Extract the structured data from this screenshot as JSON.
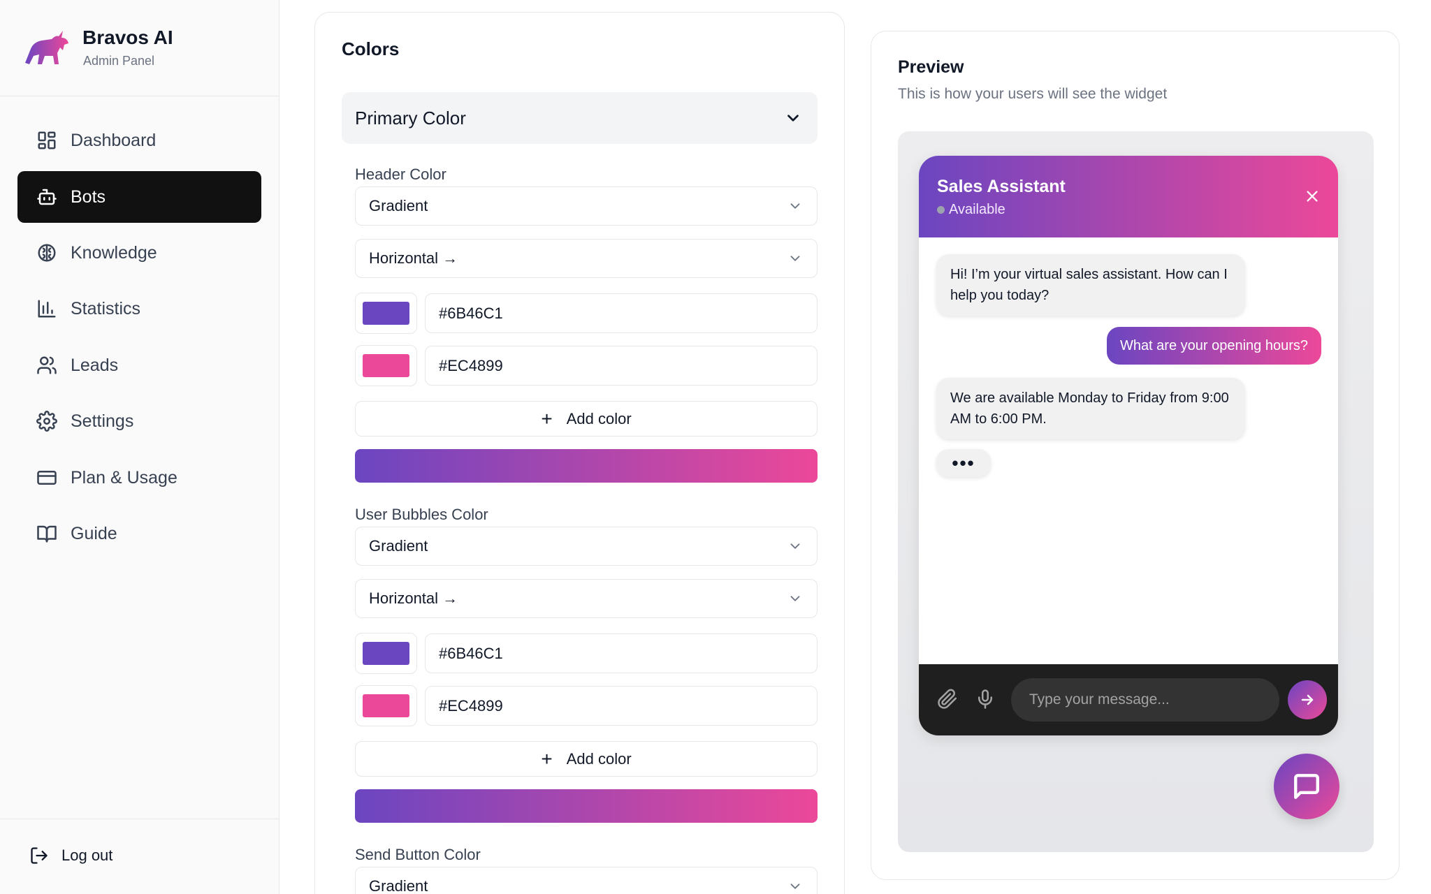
{
  "brand": {
    "name": "Bravos AI",
    "subtitle": "Admin Panel",
    "logo_icon": "bull-logo"
  },
  "sidebar": {
    "items": [
      {
        "label": "Dashboard",
        "icon": "dashboard-icon",
        "active": false
      },
      {
        "label": "Bots",
        "icon": "bot-icon",
        "active": true
      },
      {
        "label": "Knowledge",
        "icon": "brain-icon",
        "active": false
      },
      {
        "label": "Statistics",
        "icon": "bar-chart-icon",
        "active": false
      },
      {
        "label": "Leads",
        "icon": "users-icon",
        "active": false
      },
      {
        "label": "Settings",
        "icon": "gear-icon",
        "active": false
      },
      {
        "label": "Plan & Usage",
        "icon": "credit-card-icon",
        "active": false
      },
      {
        "label": "Guide",
        "icon": "book-icon",
        "active": false
      }
    ],
    "logout_label": "Log out"
  },
  "colors_panel": {
    "title": "Colors",
    "section_title": "Primary Color",
    "header_color": {
      "label": "Header Color",
      "type": "Gradient",
      "direction": "Horizontal →",
      "colors": [
        "#6B46C1",
        "#EC4899"
      ],
      "add_color_label": "Add color"
    },
    "user_bubbles_color": {
      "label": "User Bubbles Color",
      "type": "Gradient",
      "direction": "Horizontal →",
      "colors": [
        "#6B46C1",
        "#EC4899"
      ],
      "add_color_label": "Add color"
    },
    "send_button_color": {
      "label": "Send Button Color",
      "type": "Gradient"
    }
  },
  "preview": {
    "title": "Preview",
    "subtitle": "This is how your users will see the widget",
    "chat": {
      "name": "Sales Assistant",
      "status": "Available",
      "messages": [
        {
          "from": "bot",
          "text": "Hi! I’m your virtual sales assistant. How can I help you today?"
        },
        {
          "from": "user",
          "text": "What are your opening hours?"
        },
        {
          "from": "bot",
          "text": "We are available Monday to Friday from 9:00 AM to 6:00 PM."
        }
      ],
      "typing_indicator": "•••",
      "input_placeholder": "Type your message..."
    }
  },
  "theme": {
    "gradient_start": "#6B46C1",
    "gradient_end": "#EC4899",
    "active_nav_bg": "#111111"
  }
}
